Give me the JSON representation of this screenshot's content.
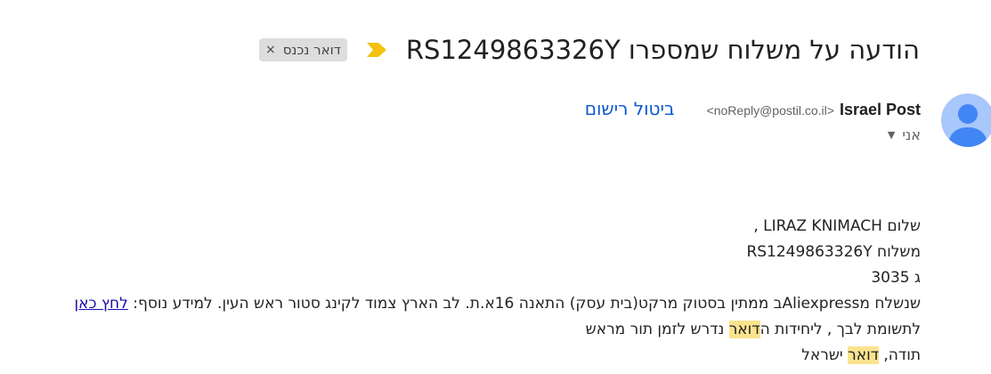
{
  "subject": {
    "title": "הודעה על משלוח שמספרו RS1249863326Y",
    "label": "דואר נכנס",
    "label_close": "×"
  },
  "sender": {
    "name": "Israel Post",
    "email": "<noReply@postil.co.il>",
    "unsubscribe": "ביטול רישום"
  },
  "recipient": {
    "text": "אני",
    "caret": "▼"
  },
  "body": {
    "greeting": "שלום LIRAZ KNIMACH ,",
    "shipment": "משלוח RS1249863326Y",
    "weight": "ג 3035",
    "line4": "שנשלח מAliexpressב ממתין בסטוק מרקט(בית עסק) התאנה 16א.ת. לב הארץ צמוד לקינג סטור ראש העין. למידע נוסף: ",
    "more_info_link": "לחץ כאן",
    "line5_before": "לתשומת לבך , ליחידות ה",
    "line5_highlight": "דואר",
    "line5_after": " נדרש לזמן תור מראש",
    "signoff_before": "תודה, ",
    "signoff_highlight": "דואר",
    "signoff_after": " ישראל"
  },
  "colors": {
    "important_marker": "#f4c20d",
    "link_blue": "#0b57d0",
    "highlight": "#fbe38e",
    "avatar_bg": "#a8c7fa",
    "avatar_fg": "#4285f4"
  },
  "icons": {
    "important": "important-marker-icon",
    "avatar": "default-avatar-icon"
  }
}
